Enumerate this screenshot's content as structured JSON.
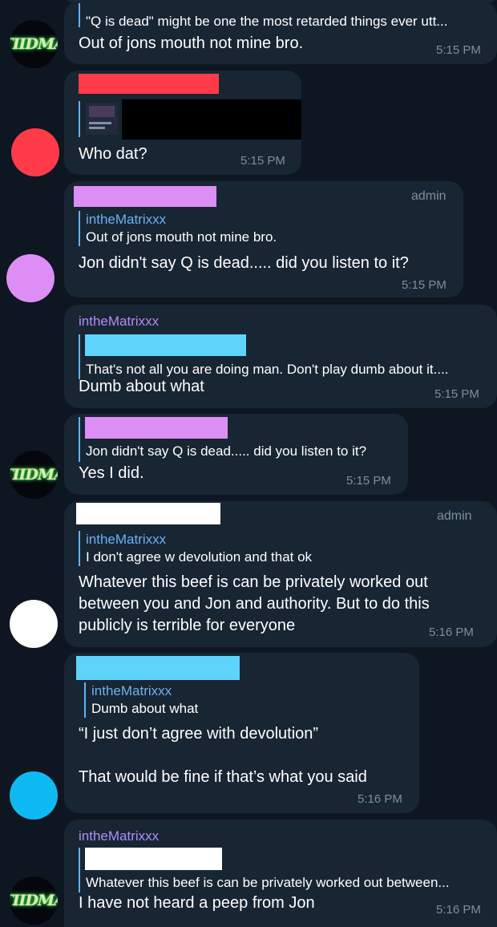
{
  "messages": [
    {
      "quote_text": "\"Q is dead\" might be one the most retarded things ever utt...",
      "text": "Out of jons mouth not mine bro.",
      "time": "5:15 PM",
      "avatar_text": "ΓIIDMA"
    },
    {
      "text": "Who dat?",
      "time": "5:15 PM",
      "colors": {
        "avatar": "#ff3b4a",
        "redacted_name": "#ff3b4a",
        "redacted_media": "#000000"
      }
    },
    {
      "badge": "admin",
      "quote_name": "intheMatrixxx",
      "quote_text": "Out of jons mouth not mine bro.",
      "text": "Jon didn't say Q is dead..... did you listen to it?",
      "time": "5:15 PM",
      "colors": {
        "avatar": "#dc8ef5",
        "redacted_name": "#dc8ef5"
      }
    },
    {
      "sender": "intheMatrixxx",
      "quote_text": "That's not all you are doing man. Don't play dumb about it....",
      "text": "Dumb about what",
      "time": "5:15 PM",
      "colors": {
        "redacted_quote": "#5ed4fa"
      }
    },
    {
      "quote_text": "Jon didn't say Q is dead..... did you listen to it?",
      "text": "Yes I did.",
      "time": "5:15 PM",
      "avatar_text": "ΓIIDMA",
      "colors": {
        "redacted_quote": "#dc8ef5"
      }
    },
    {
      "badge": "admin",
      "quote_name": "intheMatrixxx",
      "quote_text": "I don't agree w devolution and that ok",
      "lines": [
        "Whatever this beef is can be privately worked out",
        "between you and Jon and authority. But to do this",
        "publicly is terrible for everyone"
      ],
      "time": "5:16 PM",
      "colors": {
        "avatar": "#ffffff",
        "redacted_name": "#ffffff"
      }
    },
    {
      "quote_name": "intheMatrixxx",
      "quote_text": "Dumb about what",
      "lines": [
        "“I just don’t agree with devolution”",
        "",
        "That would be fine if that’s what you said"
      ],
      "time": "5:16 PM",
      "colors": {
        "avatar": "#0fbaf2",
        "redacted_name": "#5ed4fa"
      }
    },
    {
      "sender": "intheMatrixxx",
      "quote_text": "Whatever this beef is can be privately worked out between...",
      "text": "I have not heard a peep from Jon",
      "time": "5:16 PM",
      "avatar_text": "ΓIIDMA",
      "colors": {
        "redacted_quote": "#ffffff"
      }
    }
  ],
  "theme": {
    "background": "#0e1621",
    "bubble": "#182533",
    "quote_bar": "#5eb5f7",
    "quote_name": "#6ab2f2",
    "sender_name": "#b38bf7",
    "time": "#7d8e9f"
  }
}
